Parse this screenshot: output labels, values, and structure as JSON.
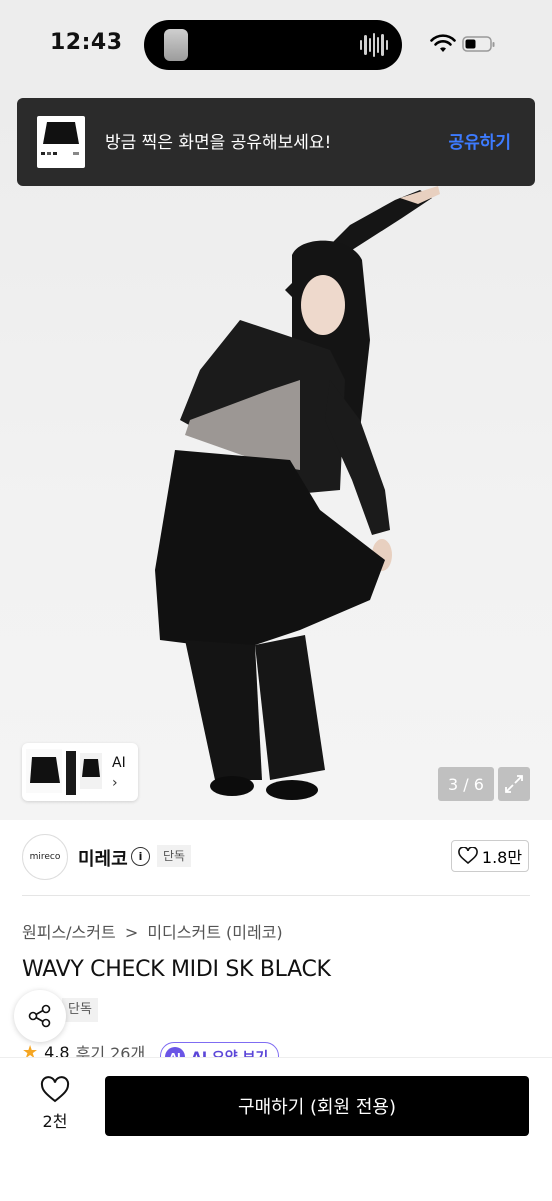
{
  "status_bar": {
    "time": "12:43"
  },
  "toast": {
    "message": "방금 찍은 화면을 공유해보세요!",
    "action": "공유하기"
  },
  "gallery": {
    "counter": "3 / 6",
    "thumb_label": "AI",
    "thumb_chevron": "›"
  },
  "brand": {
    "logo_text": "mireco",
    "name": "미레코",
    "badge": "단독",
    "like_count": "1.8만"
  },
  "breadcrumb": [
    "원피스/스커트",
    "미디스커트 (미레코)"
  ],
  "breadcrumb_sep": ">",
  "product": {
    "title": "WAVY CHECK MIDI SK BLACK",
    "badge": "단독",
    "rating": "4.8",
    "reviews": "후기 26개",
    "ai_summary": "AI 요약 보기"
  },
  "bottom_bar": {
    "wish_count": "2천",
    "buy_label": "구매하기 (회원 전용)"
  },
  "colors": {
    "toast_bg": "#2b2b2b",
    "toast_action": "#3d7bff",
    "buy_bg": "#000000",
    "ai_accent": "#6a55e6",
    "star": "#f5a623"
  },
  "icons": [
    "wifi-icon",
    "battery-icon",
    "info-icon",
    "heart-icon",
    "share-icon",
    "expand-icon",
    "star-icon",
    "chevron-right-icon"
  ]
}
